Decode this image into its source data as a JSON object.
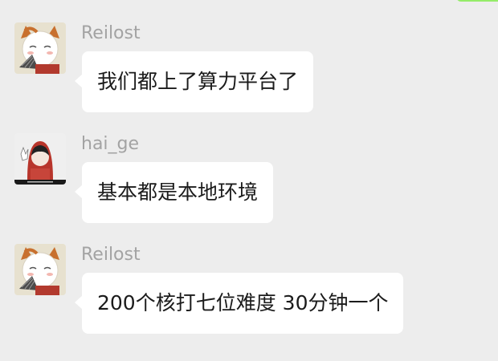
{
  "messages": [
    {
      "sender": "Reilost",
      "text": "我们都上了算力平台了",
      "avatar_icon": "cartoon-cat-with-fan-avatar"
    },
    {
      "sender": "hai_ge",
      "text": "基本都是本地环境",
      "avatar_icon": "red-hoodie-character-avatar"
    },
    {
      "sender": "Reilost",
      "text": "200个核打七位难度 30分钟一个",
      "avatar_icon": "cartoon-cat-with-fan-avatar"
    }
  ],
  "colors": {
    "background": "#ededed",
    "bubble": "#ffffff",
    "sender_name": "#a3a3a3",
    "own_bubble_accent": "#95ec69"
  }
}
